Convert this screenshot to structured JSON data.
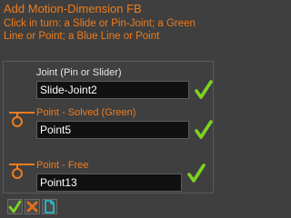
{
  "window": {
    "title": "Add Motion-Dimension FB",
    "instructions": "Click in turn: a Slide or Pin-Joint; a Green Line or Point; a Blue Line or Point"
  },
  "rows": [
    {
      "label": "Joint (Pin or Slider)",
      "value": "Slide-Joint2"
    },
    {
      "label": "Point - Solved (Green)",
      "value": "Point5"
    },
    {
      "label": "Point - Free",
      "value": "Point13"
    }
  ],
  "colors": {
    "accent": "#f07c1c",
    "check": "#7ed321",
    "background": "#3f3f3f",
    "field": "#111111",
    "cancel": "#e8701a",
    "new": "#20c8d8"
  },
  "icons": {
    "row_status": "check-icon",
    "pin_marker": "orange-pin-icon",
    "ok": "check-icon",
    "cancel": "cross-icon",
    "new": "document-icon"
  }
}
